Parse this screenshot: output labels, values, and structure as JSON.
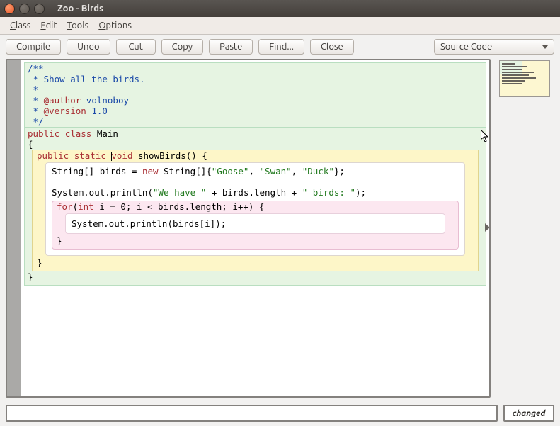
{
  "window": {
    "title": "Zoo - Birds"
  },
  "menu": {
    "class_": "Class",
    "edit": "Edit",
    "tools": "Tools",
    "options": "Options"
  },
  "toolbar": {
    "compile": "Compile",
    "undo": "Undo",
    "cut": "Cut",
    "copy": "Copy",
    "paste": "Paste",
    "find": "Find...",
    "close": "Close"
  },
  "view_select": {
    "value": "Source Code"
  },
  "status": {
    "text": "",
    "state": "changed"
  },
  "code": {
    "comment_open": "/**",
    "comment_l1": " * Show all the birds.",
    "comment_l2": " *",
    "comment_l3": " * @author volnoboy",
    "comment_l4": " * @version 1.0",
    "comment_close": " */",
    "kw_public": "public",
    "kw_class": "class",
    "class_name": " Main",
    "brace_open": "{",
    "brace_close": "}",
    "kw_static": "static",
    "kw_void": "void",
    "method_sig": " showBirds() {",
    "line_arr_a": "String[] birds = ",
    "kw_new": "new",
    "line_arr_b": " String[]{",
    "str_goose": "\"Goose\"",
    "str_swan": "\"Swan\"",
    "str_duck": "\"Duck\"",
    "comma": ", ",
    "line_arr_c": "};",
    "print1_a": "System.out.println(",
    "str_wehave": "\"We have \"",
    "print1_b": " + birds.length + ",
    "str_birds": "\" birds: \"",
    "print1_c": ");",
    "kw_for": "for",
    "for_a": "(",
    "kw_int": "int",
    "for_b": " i = 0; i < birds.length; i++) {",
    "print2": "System.out.println(birds[i]);",
    "method_close": "}"
  }
}
